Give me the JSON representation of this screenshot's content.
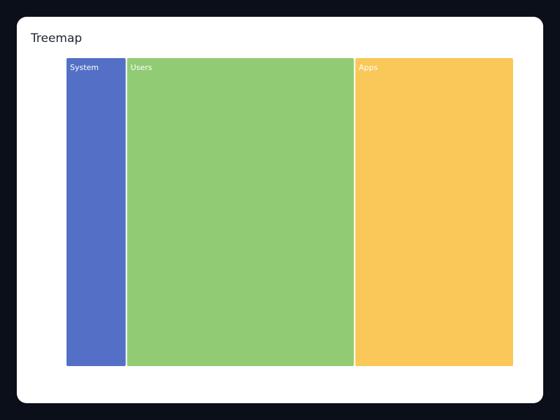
{
  "chart_data": {
    "type": "treemap",
    "title": "Treemap",
    "categories": [
      "System",
      "Users",
      "Apps"
    ],
    "values": [
      12,
      46,
      32
    ],
    "colors": [
      "#5470c6",
      "#91cc75",
      "#fac858"
    ]
  }
}
